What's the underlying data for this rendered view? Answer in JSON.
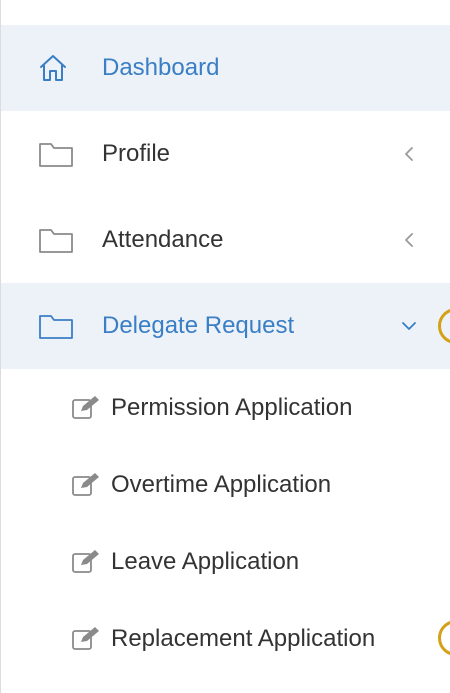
{
  "menu": {
    "items": [
      {
        "label": "Dashboard",
        "icon": "home-icon",
        "active": true,
        "highlight": true,
        "chevron": ""
      },
      {
        "label": "Profile",
        "icon": "folder-icon",
        "active": false,
        "highlight": false,
        "chevron": "chevron-left-icon"
      },
      {
        "label": "Attendance",
        "icon": "folder-icon",
        "active": false,
        "highlight": false,
        "chevron": "chevron-left-icon"
      },
      {
        "label": "Delegate Request",
        "icon": "folder-icon",
        "active": true,
        "highlight": true,
        "chevron": "chevron-down-icon"
      }
    ],
    "subitems": [
      {
        "label": "Permission Application",
        "icon": "edit-icon"
      },
      {
        "label": "Overtime Application",
        "icon": "edit-icon"
      },
      {
        "label": "Leave Application",
        "icon": "edit-icon"
      },
      {
        "label": "Replacement Application",
        "icon": "edit-icon"
      }
    ]
  },
  "colors": {
    "active_bg": "#edf2f8",
    "accent": "#3a7ec5",
    "text": "#333333",
    "icon_gray": "#8a8a8a",
    "badge": "#d4a017"
  }
}
